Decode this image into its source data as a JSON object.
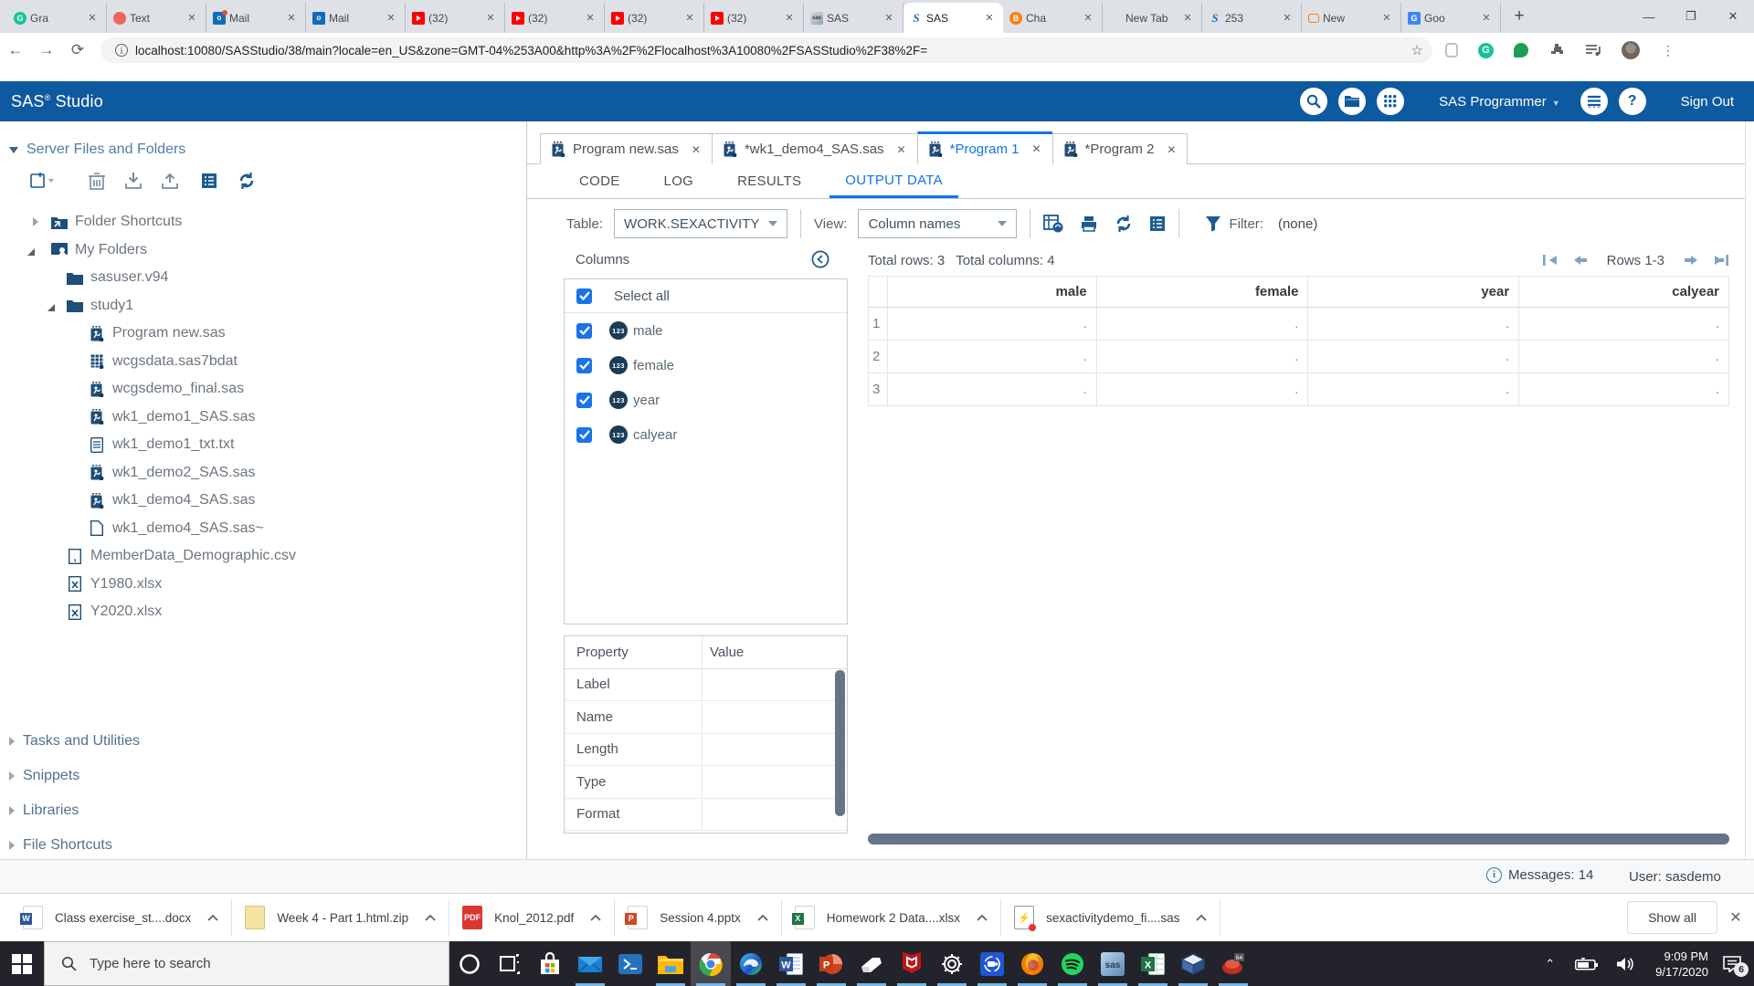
{
  "browser": {
    "tabs": [
      {
        "icon": "grammarly",
        "label": "Gra"
      },
      {
        "icon": "red-circle",
        "label": "Text"
      },
      {
        "icon": "outlook-dot",
        "label": "Mail"
      },
      {
        "icon": "outlook",
        "label": "Mail"
      },
      {
        "icon": "youtube",
        "label": "(32)"
      },
      {
        "icon": "youtube",
        "label": "(32)"
      },
      {
        "icon": "youtube",
        "label": "(32)"
      },
      {
        "icon": "youtube",
        "label": "(32)"
      },
      {
        "icon": "sas-gray",
        "label": "SAS"
      },
      {
        "icon": "sas-blue",
        "label": "SAS",
        "active": true
      },
      {
        "icon": "blackboard",
        "label": "Cha"
      },
      {
        "icon": "none",
        "label": "New Tab"
      },
      {
        "icon": "sas-blue",
        "label": "253"
      },
      {
        "icon": "chat-orange",
        "label": "New"
      },
      {
        "icon": "translate",
        "label": "Goo"
      }
    ],
    "close_glyph": "✕",
    "new_tab_glyph": "+",
    "window_controls": {
      "minimize": "—",
      "maximize": "❐",
      "close": "✕"
    },
    "back": "←",
    "forward": "→",
    "reload": "⟳",
    "url": "localhost:10080/SASStudio/38/main?locale=en_US&zone=GMT-04%253A00&http%3A%2F%2Flocalhost%3A10080%2FSASStudio%2F38%2F=",
    "star": "☆",
    "menu_dots": "⋮",
    "grammarly_ext": "G"
  },
  "app_header": {
    "brand": "SAS",
    "brand_sup": "®",
    "brand_rest": " Studio",
    "role": "SAS Programmer",
    "help": "?",
    "sign_out": "Sign Out"
  },
  "sidebar": {
    "section_title": "Server Files and Folders",
    "tree": [
      {
        "indent": 0,
        "caret": "collapsed",
        "icon": "folder-shortcut",
        "label": "Folder Shortcuts"
      },
      {
        "indent": 0,
        "caret": "expanded",
        "icon": "my-folders",
        "label": "My Folders"
      },
      {
        "indent": 1,
        "caret": "none",
        "icon": "folder",
        "label": "sasuser.v94"
      },
      {
        "indent": 1,
        "caret": "expanded",
        "icon": "folder",
        "label": "study1"
      },
      {
        "indent": 2,
        "caret": "none",
        "icon": "sas-program",
        "label": "Program new.sas"
      },
      {
        "indent": 2,
        "caret": "none",
        "icon": "sas-data",
        "label": "wcgsdata.sas7bdat"
      },
      {
        "indent": 2,
        "caret": "none",
        "icon": "sas-program",
        "label": "wcgsdemo_final.sas"
      },
      {
        "indent": 2,
        "caret": "none",
        "icon": "sas-program",
        "label": "wk1_demo1_SAS.sas"
      },
      {
        "indent": 2,
        "caret": "none",
        "icon": "txt-file",
        "label": "wk1_demo1_txt.txt"
      },
      {
        "indent": 2,
        "caret": "none",
        "icon": "sas-program",
        "label": "wk1_demo2_SAS.sas"
      },
      {
        "indent": 2,
        "caret": "none",
        "icon": "sas-program",
        "label": "wk1_demo4_SAS.sas"
      },
      {
        "indent": 2,
        "caret": "none",
        "icon": "plain-file",
        "label": "wk1_demo4_SAS.sas~"
      },
      {
        "indent": 1,
        "caret": "none",
        "icon": "csv-file",
        "label": "MemberData_Demographic.csv"
      },
      {
        "indent": 1,
        "caret": "none",
        "icon": "xls-file",
        "label": "Y1980.xlsx"
      },
      {
        "indent": 1,
        "caret": "none",
        "icon": "xls-file",
        "label": "Y2020.xlsx"
      }
    ],
    "bottom_sections": [
      "Tasks and Utilities",
      "Snippets",
      "Libraries",
      "File Shortcuts"
    ]
  },
  "doc_tabs": [
    {
      "label": "Program new.sas"
    },
    {
      "label": "*wk1_demo4_SAS.sas"
    },
    {
      "label": "*Program 1",
      "active": true
    },
    {
      "label": "*Program 2"
    }
  ],
  "subtabs": {
    "items": [
      "CODE",
      "LOG",
      "RESULTS",
      "OUTPUT DATA"
    ],
    "active_index": 3
  },
  "controls": {
    "table_label": "Table:",
    "table_value": "WORK.SEXACTIVITY",
    "view_label": "View:",
    "view_value": "Column names",
    "filter_label": "Filter:",
    "filter_value": "(none)"
  },
  "columns_panel": {
    "title": "Columns",
    "select_all": "Select all",
    "items": [
      {
        "type": "numeric",
        "label": "male",
        "checked": true
      },
      {
        "type": "numeric",
        "label": "female",
        "checked": true
      },
      {
        "type": "numeric",
        "label": "year",
        "checked": true
      },
      {
        "type": "numeric",
        "label": "calyear",
        "checked": true
      }
    ],
    "numeric_badge": "123"
  },
  "properties_panel": {
    "header_property": "Property",
    "header_value": "Value",
    "rows": [
      "Label",
      "Name",
      "Length",
      "Type",
      "Format"
    ]
  },
  "data_panel": {
    "total_rows_label": "Total rows: 3",
    "total_cols_label": "Total columns: 4",
    "pagination_label": "Rows 1-3",
    "table": {
      "type": "table",
      "columns": [
        "male",
        "female",
        "year",
        "calyear"
      ],
      "row_numbers": [
        "1",
        "2",
        "3"
      ],
      "rows": [
        [
          ".",
          ".",
          ".",
          "."
        ],
        [
          ".",
          ".",
          ".",
          "."
        ],
        [
          ".",
          ".",
          ".",
          "."
        ]
      ]
    }
  },
  "status_bar": {
    "messages": "Messages: 14",
    "user": "User: sasdemo",
    "info_glyph": "i"
  },
  "downloads": {
    "items": [
      {
        "type": "word",
        "label": "Class exercise_st....docx"
      },
      {
        "type": "zip",
        "label": "Week 4 - Part 1.html.zip"
      },
      {
        "type": "pdf",
        "label": "Knol_2012.pdf",
        "badge": "PDF"
      },
      {
        "type": "ppt",
        "label": "Session 4.pptx"
      },
      {
        "type": "xls",
        "label": "Homework 2 Data....xlsx"
      },
      {
        "type": "sas",
        "label": "sexactivitydemo_fi....sas"
      }
    ],
    "show_all": "Show all",
    "close_glyph": "✕"
  },
  "taskbar": {
    "search_placeholder": "Type here to search",
    "icons": [
      "cortana",
      "taskview",
      "store",
      "mail",
      "powershell",
      "explorer",
      "chrome",
      "edge",
      "word",
      "powerpoint",
      "eraser",
      "mcafee",
      "settings",
      "recorder",
      "firefox",
      "spotify",
      "sas",
      "excel",
      "virtualbox",
      "wine"
    ],
    "running": [
      "mail",
      "explorer",
      "chrome",
      "edge",
      "word",
      "powerpoint",
      "eraser",
      "mcafee",
      "settings",
      "recorder",
      "firefox",
      "spotify",
      "sas",
      "excel",
      "virtualbox",
      "wine"
    ],
    "active_window": "chrome",
    "tray_chevron": "⌃",
    "clock_time": "9:09 PM",
    "clock_date": "9/17/2020",
    "notification_count": "6"
  }
}
